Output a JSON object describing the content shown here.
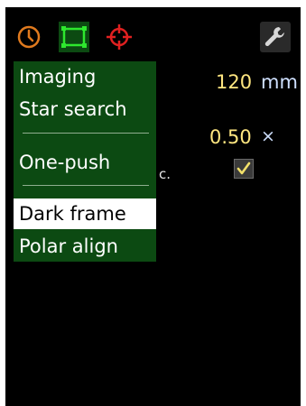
{
  "toolbar": {
    "icons": [
      "clock-icon",
      "frame-icon",
      "crosshair-icon",
      "wrench-icon"
    ],
    "active": "frame"
  },
  "settings": {
    "focal_length_value": "120",
    "focal_length_unit": "mm",
    "ratio_value": "0.50",
    "ratio_unit": "×",
    "partial_label": "c.",
    "checkbox_checked": true
  },
  "dropdown": {
    "items": [
      {
        "label": "Imaging"
      },
      {
        "label": "Star search"
      },
      {
        "label": "One-push"
      },
      {
        "label": "Dark frame"
      },
      {
        "label": "Polar align"
      }
    ],
    "selected": "Dark frame"
  },
  "colors": {
    "background": "#000000",
    "menu_green": "#0c4a12",
    "value_yellow": "#ffe680",
    "unit_blue": "#cfe0ff",
    "accent_orange": "#e07a1e",
    "accent_green": "#2ee82e",
    "accent_red": "#e02020"
  }
}
